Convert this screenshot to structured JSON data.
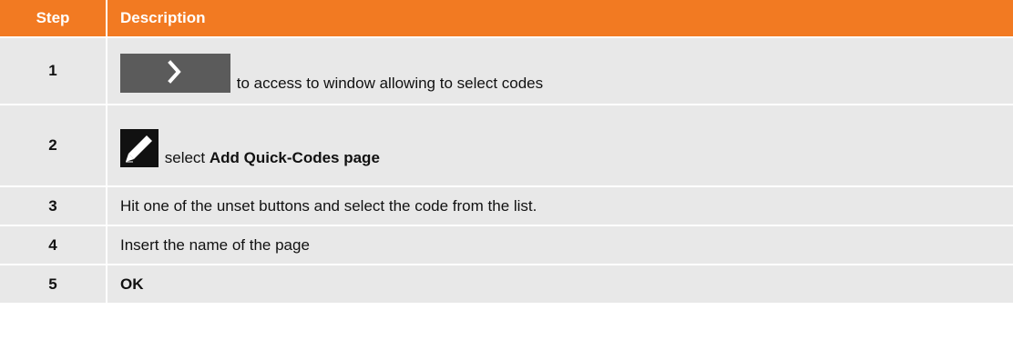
{
  "table": {
    "header": {
      "step": "Step",
      "description": "Description"
    },
    "rows": [
      {
        "step": "1",
        "icon": "chevron-right-icon",
        "text": "to access to window allowing to select codes"
      },
      {
        "step": "2",
        "icon": "pencil-edit-icon",
        "text_prefix": "select ",
        "text_bold": "Add Quick-Codes page"
      },
      {
        "step": "3",
        "text": "Hit one of the unset buttons and select the code from the list."
      },
      {
        "step": "4",
        "text": "Insert the name of the page"
      },
      {
        "step": "5",
        "text_bold": "OK"
      }
    ]
  },
  "colors": {
    "header_bg": "#f27a22",
    "row_bg": "#e8e8e8",
    "next_button_bg": "#5b5b5b",
    "edit_button_bg": "#111111"
  }
}
